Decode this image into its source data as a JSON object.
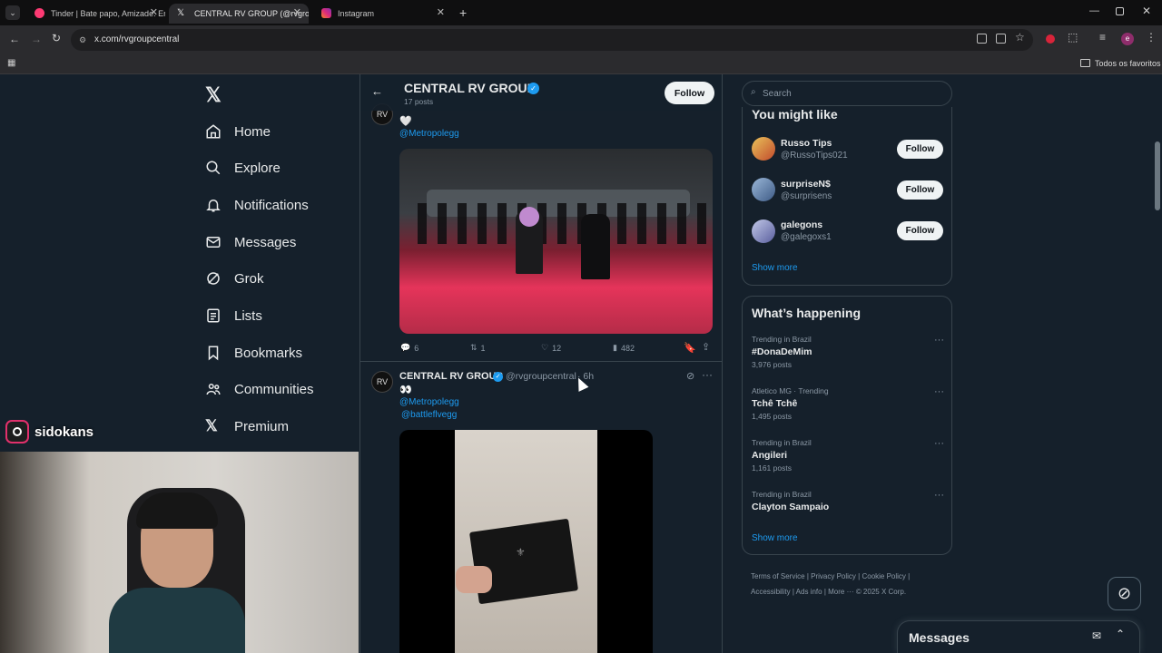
{
  "browser": {
    "tabs": [
      {
        "title": "Tinder | Bate papo, Amizade. En",
        "active": false
      },
      {
        "title": "CENTRAL RV GROUP (@rvgrou",
        "active": true
      },
      {
        "title": "Instagram",
        "active": false
      }
    ],
    "url": "x.com/rvgroupcentral",
    "bookmarks_label": "Todos os favoritos"
  },
  "nav": {
    "items": [
      "Home",
      "Explore",
      "Notifications",
      "Messages",
      "Grok",
      "Lists",
      "Bookmarks",
      "Communities",
      "Premium"
    ]
  },
  "header": {
    "name": "CENTRAL RV GROUP",
    "posts": "17 posts",
    "follow_label": "Follow"
  },
  "tweet1": {
    "emoji": "🤍",
    "mention": "@Metropolegg",
    "replies": "6",
    "retweets": "1",
    "likes": "12",
    "views": "482"
  },
  "tweet2": {
    "name": "CENTRAL RV GROUP",
    "handle": "@rvgroupcentral",
    "time": "· 6h",
    "emoji": "👀",
    "mention1": "@Metropolegg",
    "mention2": "@battleflvegg"
  },
  "search": {
    "placeholder": "Search"
  },
  "you_might_like": {
    "title": "You might like",
    "accounts": [
      {
        "name": "Russo Tips",
        "handle": "@RussoTips021",
        "follow": "Follow"
      },
      {
        "name": "surpriseN$",
        "handle": "@surprisens",
        "follow": "Follow"
      },
      {
        "name": "galegons",
        "handle": "@galegoxs1",
        "follow": "Follow"
      }
    ],
    "show_more": "Show more"
  },
  "happening": {
    "title": "What’s happening",
    "trends": [
      {
        "meta": "Trending in Brazil",
        "name": "#DonaDeMim",
        "count": "3,976 posts"
      },
      {
        "meta": "Atletico MG · Trending",
        "name": "Tchê Tchê",
        "count": "1,495 posts"
      },
      {
        "meta": "Trending in Brazil",
        "name": "Angileri",
        "count": "1,161 posts"
      },
      {
        "meta": "Trending in Brazil",
        "name": "Clayton Sampaio",
        "count": ""
      }
    ],
    "show_more": "Show more"
  },
  "footer": {
    "terms": "Terms of Service",
    "privacy": "Privacy Policy",
    "cookie": "Cookie Policy",
    "accessibility": "Accessibility",
    "ads": "Ads info",
    "more": "More ···",
    "copyright": "© 2025 X Corp."
  },
  "messages_drawer": {
    "title": "Messages"
  },
  "streamer": {
    "username": "sidokans"
  },
  "colors": {
    "accent": "#1d9bf0",
    "bg": "#15202b",
    "border": "#38444d"
  }
}
